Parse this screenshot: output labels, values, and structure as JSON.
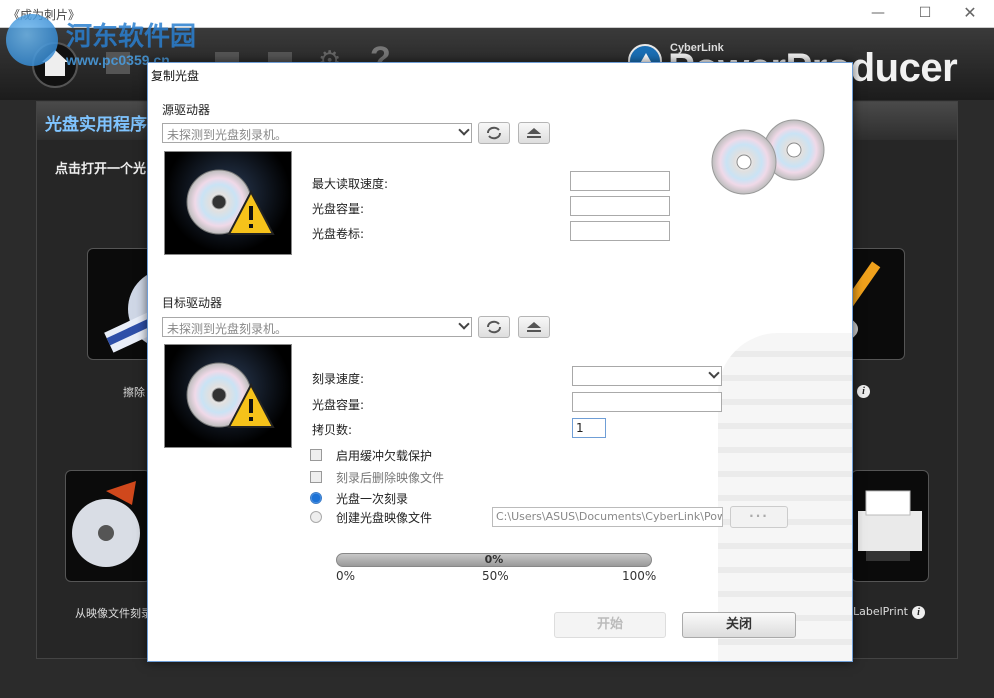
{
  "window": {
    "title": "《成为刺片》",
    "minimize": "—",
    "maximize": "☐",
    "close": "✕"
  },
  "watermark": {
    "text": "河东软件园",
    "url": "www.pc0359.cn"
  },
  "brand": {
    "company": "CyberLink",
    "product": "PowerProducer"
  },
  "panel": {
    "title": "光盘实用程序",
    "subtitle": "点击打开一个光",
    "tiles": [
      {
        "label": "擦除"
      },
      {
        "label": "从映像文件刻录"
      },
      {
        "label": "LabelPrint"
      }
    ]
  },
  "dialog": {
    "title": "复制光盘",
    "source": {
      "label": "源驱动器",
      "drive_value": "未探测到光盘刻录机。",
      "fields": [
        {
          "label": "最大读取速度:",
          "value": ""
        },
        {
          "label": "光盘容量:",
          "value": ""
        },
        {
          "label": "光盘卷标:",
          "value": ""
        }
      ]
    },
    "target": {
      "label": "目标驱动器",
      "drive_value": "未探测到光盘刻录机。",
      "burn_speed_label": "刻录速度:",
      "burn_speed_value": "",
      "capacity_label": "光盘容量:",
      "capacity_value": "",
      "copies_label": "拷贝数:",
      "copies_value": "1"
    },
    "options": {
      "buffer_protect": "启用缓冲欠载保护",
      "delete_image": "刻录后删除映像文件",
      "burn_once": "光盘一次刻录",
      "create_image": "创建光盘映像文件",
      "image_path": "C:\\Users\\ASUS\\Documents\\CyberLink\\Pow",
      "browse": "···"
    },
    "progress": {
      "value": 0,
      "text": "0%",
      "tick_0": "0%",
      "tick_50": "50%",
      "tick_100": "100%"
    },
    "buttons": {
      "start": "开始",
      "close": "关闭"
    }
  },
  "colors": {
    "accent": "#1c72d6",
    "panel_title": "#7fc4ff"
  }
}
